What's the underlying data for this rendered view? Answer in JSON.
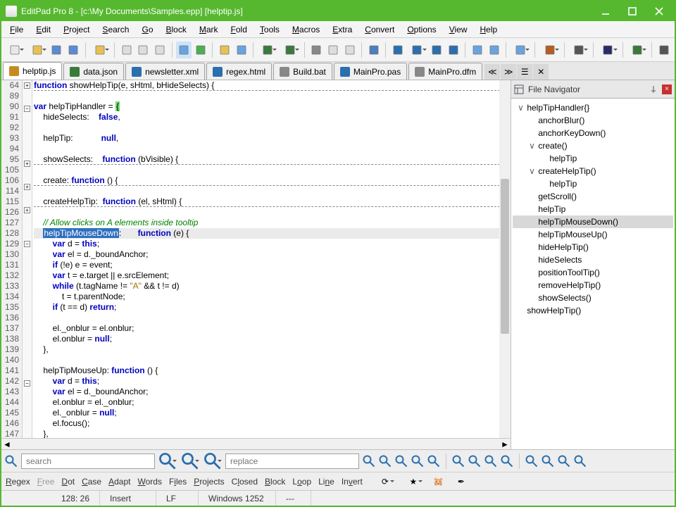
{
  "window": {
    "title": "EditPad Pro 8 - [c:\\My Documents\\Samples.epp] [helptip.js]"
  },
  "menu": [
    "File",
    "Edit",
    "Project",
    "Search",
    "Go",
    "Block",
    "Mark",
    "Fold",
    "Tools",
    "Macros",
    "Extra",
    "Convert",
    "Options",
    "View",
    "Help"
  ],
  "tabs": [
    {
      "label": "helptip.js",
      "active": true
    },
    {
      "label": "data.json"
    },
    {
      "label": "newsletter.xml"
    },
    {
      "label": "regex.html"
    },
    {
      "label": "Build.bat"
    },
    {
      "label": "MainPro.pas"
    },
    {
      "label": "MainPro.dfm"
    }
  ],
  "gutter": [
    "64",
    "89",
    "90",
    "91",
    "92",
    "93",
    "94",
    "95",
    "105",
    "106",
    "114",
    "115",
    "126",
    "127",
    "128",
    "129",
    "130",
    "131",
    "132",
    "133",
    "134",
    "135",
    "136",
    "137",
    "138",
    "139",
    "140",
    "141",
    "142",
    "143",
    "144",
    "145",
    "146",
    "147"
  ],
  "code_lines_html": [
    "<span class='kw'>function</span> showHelpTip(e, sHtml, bHideSelects) {",
    "",
    "<span class='kw'>var</span> helpTipHandler = <span class='hl-brace'>{</span>",
    "    hideSelects:    <span class='kw'>false</span>,",
    "",
    "    helpTip:            <span class='kw'>null</span>,",
    "",
    "    showSelects:    <span class='kw'>function</span> (bVisible) {",
    "",
    "    create: <span class='kw'>function</span> () {",
    "",
    "    createHelpTip:  <span class='kw'>function</span> (el, sHtml) {",
    "",
    "    <span class='cmt'>// Allow clicks on A elements inside tooltip</span>",
    "    <span class='bg-sel'>helpTipMouseDown</span>:       <span class='kw'>function</span> (e) {",
    "        <span class='kw'>var</span> d = <span class='kw'>this</span>;",
    "        <span class='kw'>var</span> el = d._boundAnchor;",
    "        <span class='kw'>if</span> (!e) e = event;",
    "        <span class='kw'>var</span> t = e.target || e.srcElement;",
    "        <span class='kw'>while</span> (t.tagName != <span class='str'>\"A\"</span> && t != d)",
    "            t = t.parentNode;",
    "        <span class='kw'>if</span> (t == d) <span class='kw'>return</span>;",
    "",
    "        el._onblur = el.onblur;",
    "        el.onblur = <span class='kw'>null</span>;",
    "    },",
    "",
    "    helpTipMouseUp: <span class='kw'>function</span> () {",
    "        <span class='kw'>var</span> d = <span class='kw'>this</span>;",
    "        <span class='kw'>var</span> el = d._boundAnchor;",
    "        el.onblur = el._onblur;",
    "        el._onblur = <span class='kw'>null</span>;",
    "        el.focus();",
    "    },"
  ],
  "code_dashed_rows": [
    0,
    7,
    9,
    11
  ],
  "code_fold_rows": {
    "0": "+",
    "2": "-",
    "7": "+",
    "9": "+",
    "11": "+",
    "14": "-",
    "27": "-"
  },
  "navigator": {
    "title": "File Navigator",
    "nodes": [
      {
        "indent": 0,
        "tw": "v",
        "label": "helpTipHandler{}"
      },
      {
        "indent": 1,
        "tw": "",
        "label": "anchorBlur()"
      },
      {
        "indent": 1,
        "tw": "",
        "label": "anchorKeyDown()"
      },
      {
        "indent": 1,
        "tw": "v",
        "label": "create()"
      },
      {
        "indent": 2,
        "tw": "",
        "label": "helpTip"
      },
      {
        "indent": 1,
        "tw": "v",
        "label": "createHelpTip()"
      },
      {
        "indent": 2,
        "tw": "",
        "label": "helpTip"
      },
      {
        "indent": 1,
        "tw": "",
        "label": "getScroll()"
      },
      {
        "indent": 1,
        "tw": "",
        "label": "helpTip"
      },
      {
        "indent": 1,
        "tw": "",
        "label": "helpTipMouseDown()",
        "sel": true
      },
      {
        "indent": 1,
        "tw": "",
        "label": "helpTipMouseUp()"
      },
      {
        "indent": 1,
        "tw": "",
        "label": "hideHelpTip()"
      },
      {
        "indent": 1,
        "tw": "",
        "label": "hideSelects"
      },
      {
        "indent": 1,
        "tw": "",
        "label": "positionToolTip()"
      },
      {
        "indent": 1,
        "tw": "",
        "label": "removeHelpTip()"
      },
      {
        "indent": 1,
        "tw": "",
        "label": "showSelects()"
      },
      {
        "indent": 0,
        "tw": "",
        "label": "showHelpTip()"
      }
    ]
  },
  "search": {
    "placeholder": "search",
    "replace_placeholder": "replace"
  },
  "opts": [
    {
      "t": "Regex",
      "u": "R"
    },
    {
      "t": "Free",
      "u": "F",
      "dim": true
    },
    {
      "t": "Dot",
      "u": "D"
    },
    {
      "t": "Case",
      "u": "C"
    },
    {
      "t": "Adapt",
      "u": "A"
    },
    {
      "t": "Words",
      "u": "W"
    },
    {
      "t": "Files",
      "u": "i"
    },
    {
      "t": "Projects",
      "u": "P"
    },
    {
      "t": "Closed",
      "u": "l"
    },
    {
      "t": "Block",
      "u": "B"
    },
    {
      "t": "Loop",
      "u": "o"
    },
    {
      "t": "Line",
      "u": "n"
    },
    {
      "t": "Invert",
      "u": "v"
    }
  ],
  "status": {
    "pos": "128: 26",
    "mode": "Insert",
    "eol": "LF",
    "enc": "Windows 1252",
    "bom": "---"
  }
}
